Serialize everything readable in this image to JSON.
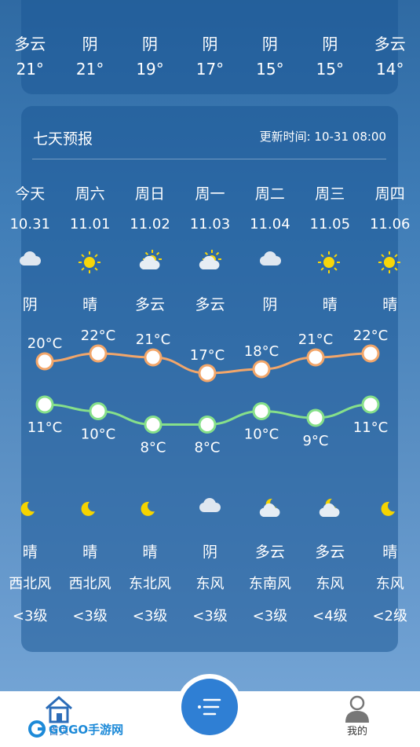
{
  "previous_strip": {
    "conditions": [
      "多云",
      "阴",
      "阴",
      "阴",
      "阴",
      "阴",
      "多云"
    ],
    "temps": [
      "21°",
      "21°",
      "19°",
      "17°",
      "15°",
      "15°",
      "14°"
    ]
  },
  "forecast": {
    "title": "七天预报",
    "update_time": "更新时间: 10-31 08:00",
    "days": [
      {
        "day": "今天",
        "date": "10.31",
        "day_cond": "阴",
        "day_icon": "cloud-icon",
        "high": "20°C",
        "night_icon": "moon-icon",
        "night_cond": "晴",
        "low": "11°C",
        "wind": "西北风",
        "level": "<3级"
      },
      {
        "day": "周六",
        "date": "11.01",
        "day_cond": "晴",
        "day_icon": "sun-icon",
        "high": "22°C",
        "night_icon": "moon-icon",
        "night_cond": "晴",
        "low": "10°C",
        "wind": "西北风",
        "level": "<3级"
      },
      {
        "day": "周日",
        "date": "11.02",
        "day_cond": "多云",
        "day_icon": "sun-cloud-icon",
        "high": "21°C",
        "night_icon": "moon-icon",
        "night_cond": "晴",
        "low": "8°C",
        "wind": "东北风",
        "level": "<3级"
      },
      {
        "day": "周一",
        "date": "11.03",
        "day_cond": "多云",
        "day_icon": "sun-cloud-icon",
        "high": "17°C",
        "night_icon": "cloud-icon",
        "night_cond": "阴",
        "low": "8°C",
        "wind": "东风",
        "level": "<3级"
      },
      {
        "day": "周二",
        "date": "11.04",
        "day_cond": "阴",
        "day_icon": "cloud-icon",
        "high": "18°C",
        "night_icon": "moon-cloud-icon",
        "night_cond": "多云",
        "low": "10°C",
        "wind": "东南风",
        "level": "<3级"
      },
      {
        "day": "周三",
        "date": "11.05",
        "day_cond": "晴",
        "day_icon": "sun-icon",
        "high": "21°C",
        "night_icon": "moon-cloud-icon",
        "night_cond": "多云",
        "low": "9°C",
        "wind": "东风",
        "level": "<4级"
      },
      {
        "day": "周四",
        "date": "11.06",
        "day_cond": "晴",
        "day_icon": "sun-icon",
        "high": "22°C",
        "night_icon": "moon-icon",
        "night_cond": "晴",
        "low": "11°C",
        "wind": "东风",
        "level": "<2级"
      }
    ],
    "high_values": [
      20,
      22,
      21,
      17,
      18,
      21,
      22
    ],
    "low_values": [
      11,
      10,
      8,
      8,
      10,
      9,
      11
    ],
    "colors": {
      "high_line": "#f2a66a",
      "low_line": "#86e08a",
      "sun": "#f7d60a",
      "moon": "#f5d400"
    }
  },
  "nav": {
    "home_label": "首页",
    "profile_label": "我的",
    "watermark": "GOGO手游网"
  }
}
